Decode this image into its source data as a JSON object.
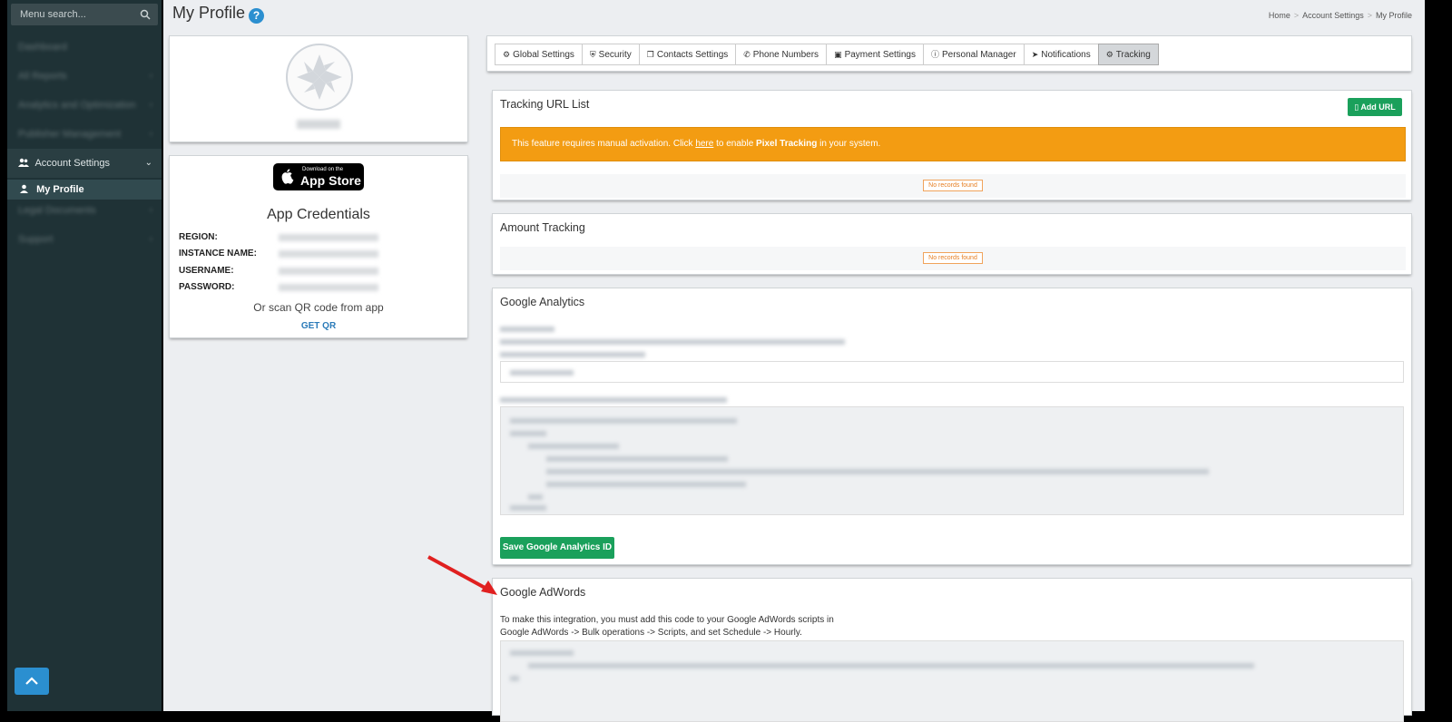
{
  "sidebar": {
    "search_placeholder": "Menu search...",
    "items": [
      {
        "label": "Dashboard",
        "blurred": true
      },
      {
        "label": "All Reports",
        "blurred": true
      },
      {
        "label": "Analytics and Optimization",
        "blurred": true
      },
      {
        "label": "Publisher Management",
        "blurred": true
      },
      {
        "label": "Account Settings",
        "blurred": false
      },
      {
        "label": "Legal Documents",
        "blurred": true
      },
      {
        "label": "Support",
        "blurred": true
      }
    ],
    "sub_item": "My Profile"
  },
  "header": {
    "title": "My Profile",
    "breadcrumb": [
      "Home",
      "Account Settings",
      "My Profile"
    ]
  },
  "profile": {
    "app_store": {
      "small": "Download on the",
      "big": "App Store"
    },
    "credentials_title": "App Credentials",
    "fields": [
      {
        "label": "REGION:"
      },
      {
        "label": "INSTANCE NAME:"
      },
      {
        "label": "USERNAME:"
      },
      {
        "label": "PASSWORD:"
      }
    ],
    "scan_text": "Or scan QR code from app",
    "get_qr": "GET QR"
  },
  "tabs": [
    {
      "label": "Global Settings",
      "icon": "gears-icon",
      "active": false
    },
    {
      "label": "Security",
      "icon": "shield-icon",
      "active": false
    },
    {
      "label": "Contacts Settings",
      "icon": "copy-icon",
      "active": false
    },
    {
      "label": "Phone Numbers",
      "icon": "phone-icon",
      "active": false
    },
    {
      "label": "Payment Settings",
      "icon": "money-icon",
      "active": false
    },
    {
      "label": "Personal Manager",
      "icon": "info-icon",
      "active": false
    },
    {
      "label": "Notifications",
      "icon": "paper-plane-icon",
      "active": false
    },
    {
      "label": "Tracking",
      "icon": "gears-icon",
      "active": true
    }
  ],
  "tracking_url": {
    "title": "Tracking URL List",
    "add_button": "Add URL",
    "alert_prefix": "This feature requires manual activation. Click ",
    "alert_link": "here",
    "alert_middle": " to enable ",
    "alert_bold": "Pixel Tracking",
    "alert_suffix": " in your system.",
    "no_records": "No records found"
  },
  "amount_tracking": {
    "title": "Amount Tracking",
    "no_records": "No records found"
  },
  "google_analytics": {
    "title": "Google Analytics",
    "save_button": "Save Google Analytics ID"
  },
  "google_adwords": {
    "title": "Google AdWords",
    "desc_line1": "To make this integration, you must add this code to your Google AdWords scripts in",
    "desc_line2": "Google AdWords -> Bulk operations -> Scripts, and set Schedule -> Hourly."
  },
  "colors": {
    "sidebar_bg": "#1f3236",
    "accent_blue": "#2b8fd0",
    "success_green": "#1aa05b",
    "warning_orange": "#f39c12"
  }
}
